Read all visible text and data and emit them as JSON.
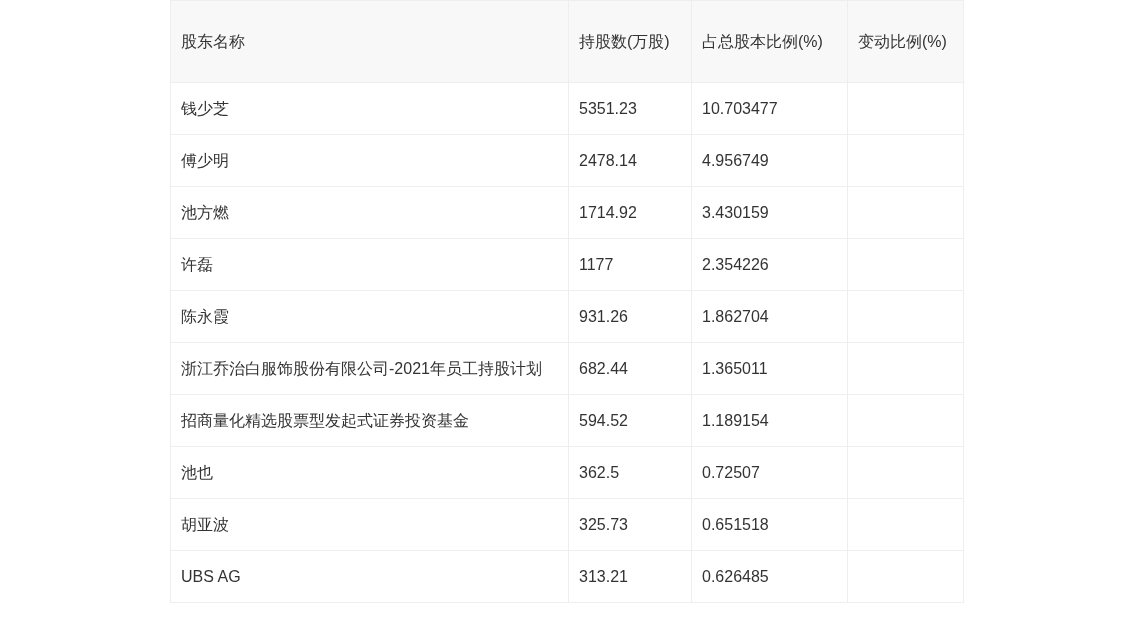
{
  "table": {
    "columns": [
      "股东名称",
      "持股数(万股)",
      "占总股本比例(%)",
      "变动比例(%)"
    ],
    "rows": [
      [
        "钱少芝",
        "5351.23",
        "10.703477",
        ""
      ],
      [
        "傅少明",
        "2478.14",
        "4.956749",
        ""
      ],
      [
        "池方燃",
        "1714.92",
        "3.430159",
        ""
      ],
      [
        "许磊",
        "1177",
        "2.354226",
        ""
      ],
      [
        "陈永霞",
        "931.26",
        "1.862704",
        ""
      ],
      [
        "浙江乔治白服饰股份有限公司-2021年员工持股计划",
        "682.44",
        "1.365011",
        ""
      ],
      [
        "招商量化精选股票型发起式证券投资基金",
        "594.52",
        "1.189154",
        ""
      ],
      [
        "池也",
        "362.5",
        "0.72507",
        ""
      ],
      [
        "胡亚波",
        "325.73",
        "0.651518",
        ""
      ],
      [
        "UBS AG",
        "313.21",
        "0.626485",
        ""
      ]
    ]
  }
}
